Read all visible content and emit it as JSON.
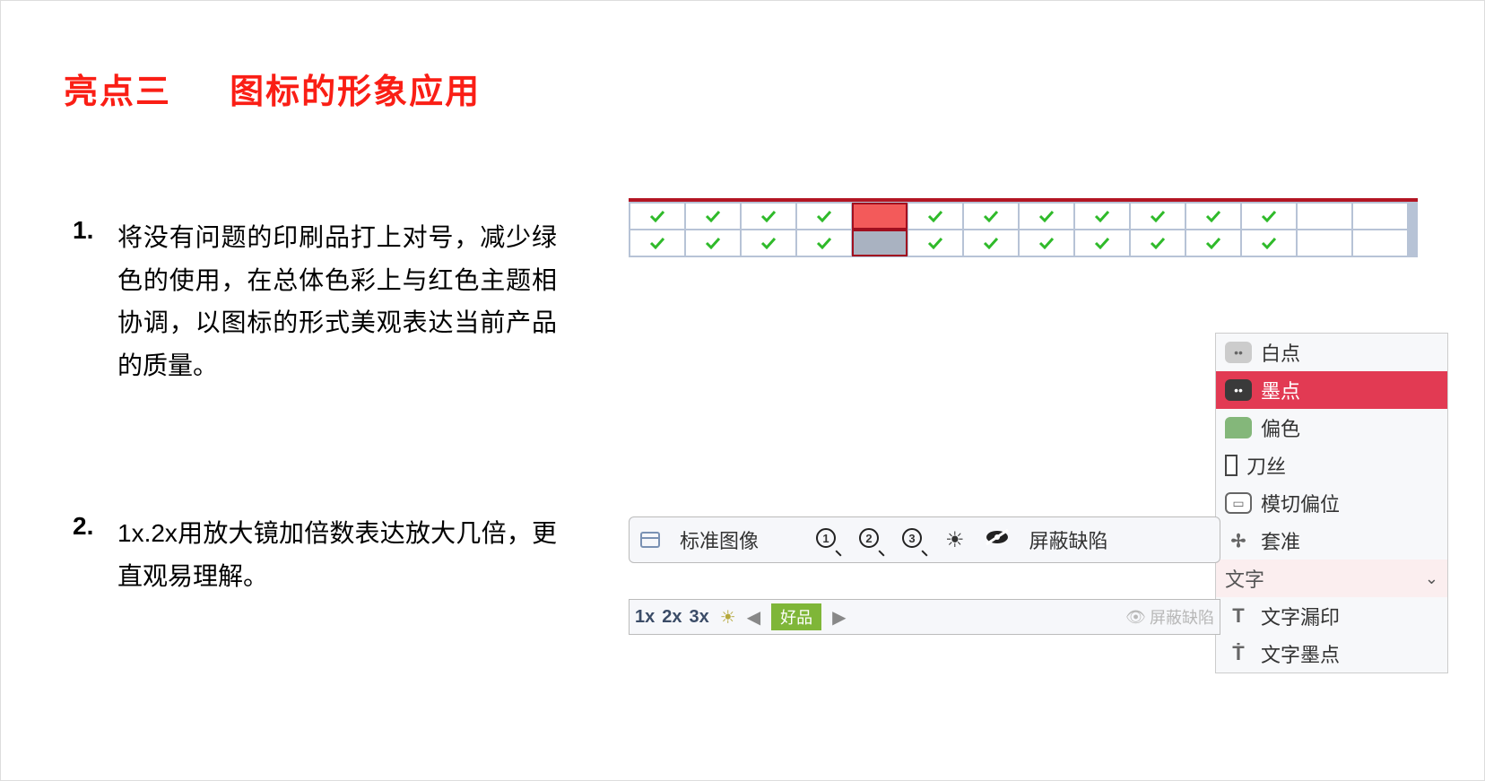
{
  "title": {
    "part1": "亮点三",
    "part2": "图标的形象应用"
  },
  "items": [
    {
      "num": "1.",
      "text": "将没有问题的印刷品打上对号，减少绿色的使用，在总体色彩上与红色主题相协调，以图标的形式美观表达当前产品的质量。"
    },
    {
      "num": "2.",
      "text": "1x.2x用放大镜加倍数表达放大几倍，更直观易理解。"
    }
  ],
  "status_grid": {
    "cols": 14,
    "rows": [
      {
        "cells": [
          {
            "check": true
          },
          {
            "check": true
          },
          {
            "check": true
          },
          {
            "check": true
          },
          {
            "check": false,
            "highlight": "top"
          },
          {
            "check": true
          },
          {
            "check": true
          },
          {
            "check": true
          },
          {
            "check": true
          },
          {
            "check": true
          },
          {
            "check": true
          },
          {
            "check": true
          },
          {
            "check": false
          },
          {
            "check": false
          }
        ]
      },
      {
        "cells": [
          {
            "check": true
          },
          {
            "check": true
          },
          {
            "check": true
          },
          {
            "check": true
          },
          {
            "check": false,
            "highlight": "bottom"
          },
          {
            "check": true
          },
          {
            "check": true
          },
          {
            "check": true
          },
          {
            "check": true
          },
          {
            "check": true
          },
          {
            "check": true
          },
          {
            "check": true
          },
          {
            "check": false
          },
          {
            "check": false
          }
        ]
      }
    ]
  },
  "defect_list": [
    {
      "id": "white-dot",
      "label": "白点",
      "icon": "dots-light"
    },
    {
      "id": "ink-dot",
      "label": "墨点",
      "icon": "dots-dark",
      "active": true
    },
    {
      "id": "color-shift",
      "label": "偏色",
      "icon": "green-blob"
    },
    {
      "id": "knife-line",
      "label": "刀丝",
      "icon": "bar"
    },
    {
      "id": "diecut-off",
      "label": "模切偏位",
      "icon": "outline-box"
    },
    {
      "id": "register",
      "label": "套准",
      "icon": "crosshair"
    },
    {
      "id": "text-group",
      "label": "文字",
      "sub": true
    },
    {
      "id": "text-miss",
      "label": "文字漏印",
      "icon": "T"
    },
    {
      "id": "text-dot",
      "label": "文字墨点",
      "icon": "T-dot"
    }
  ],
  "toolbar1": {
    "std_image": "标准图像",
    "mags": [
      "1",
      "2",
      "3"
    ],
    "mask_label": "屏蔽缺陷"
  },
  "toolbar2": {
    "zooms": [
      "1x",
      "2x",
      "3x"
    ],
    "badge": "好品",
    "mute_label": "屏蔽缺陷"
  }
}
